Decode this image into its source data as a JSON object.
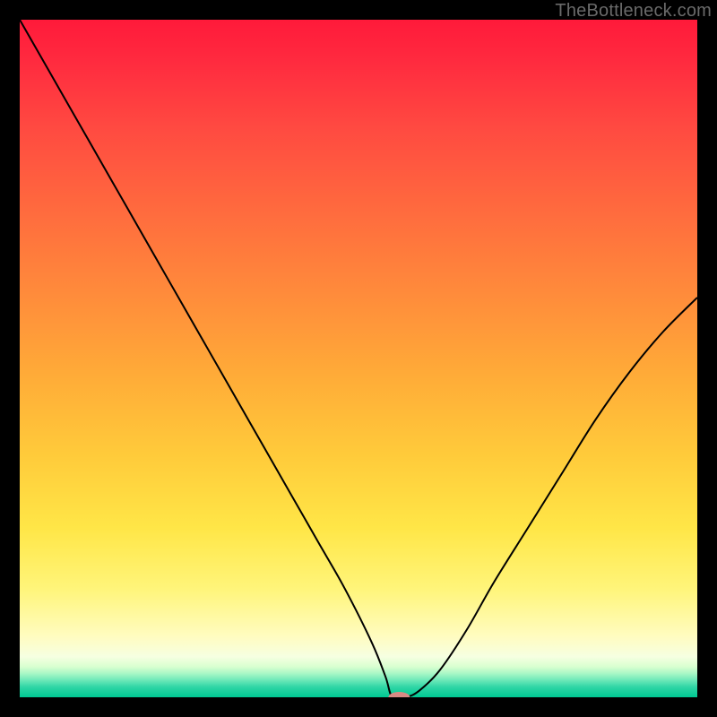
{
  "watermark": "TheBottleneck.com",
  "chart_data": {
    "type": "line",
    "title": "",
    "xlabel": "",
    "ylabel": "",
    "xlim": [
      0,
      100
    ],
    "ylim": [
      0,
      100
    ],
    "grid": false,
    "series": [
      {
        "name": "curve",
        "x": [
          0,
          4,
          8,
          12,
          16,
          20,
          24,
          28,
          32,
          36,
          40,
          44,
          48,
          52,
          54,
          55,
          57,
          59,
          62,
          66,
          70,
          75,
          80,
          85,
          90,
          95,
          100
        ],
        "y": [
          100,
          93,
          86,
          79,
          72,
          65,
          58,
          51,
          44,
          37,
          30,
          23,
          16,
          8,
          3,
          0,
          0,
          1,
          4,
          10,
          17,
          25,
          33,
          41,
          48,
          54,
          59
        ]
      }
    ],
    "marker": {
      "x": 56,
      "y": 0,
      "color": "#d88a84",
      "rx": 12,
      "ry": 6
    },
    "gradient_stops": [
      {
        "pos": 0,
        "color": "#ff1a3a"
      },
      {
        "pos": 50,
        "color": "#ffaa38"
      },
      {
        "pos": 85,
        "color": "#fffcc0"
      },
      {
        "pos": 100,
        "color": "#00c993"
      }
    ]
  }
}
